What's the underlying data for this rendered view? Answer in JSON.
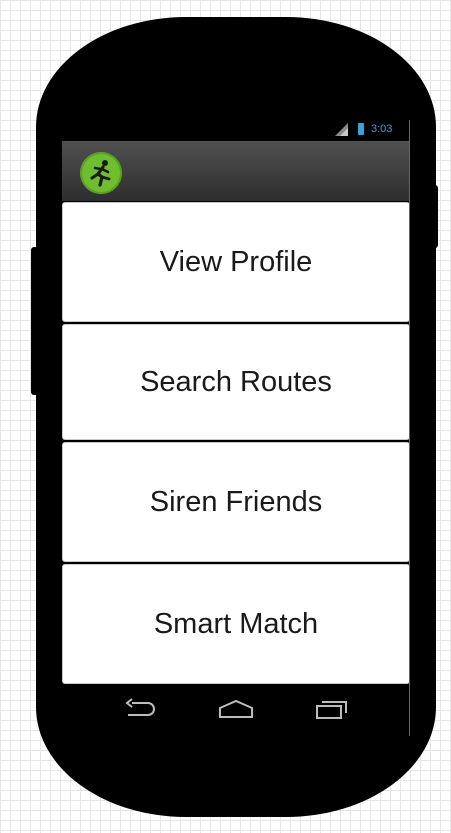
{
  "status_bar": {
    "time": "3:03",
    "signal_icon": "signal-icon",
    "battery_icon": "battery-icon"
  },
  "action_bar": {
    "app_icon": "running-man-icon"
  },
  "menu": {
    "items": [
      {
        "label": "View Profile"
      },
      {
        "label": "Search Routes"
      },
      {
        "label": "Siren Friends"
      },
      {
        "label": "Smart Match"
      }
    ]
  },
  "nav_bar": {
    "back_icon": "back-arrow-icon",
    "home_icon": "home-icon",
    "recent_icon": "recent-apps-icon"
  },
  "colors": {
    "status_accent": "#3aa3d9",
    "app_icon_green": "#6fbe2f",
    "phone_body": "#000000"
  }
}
